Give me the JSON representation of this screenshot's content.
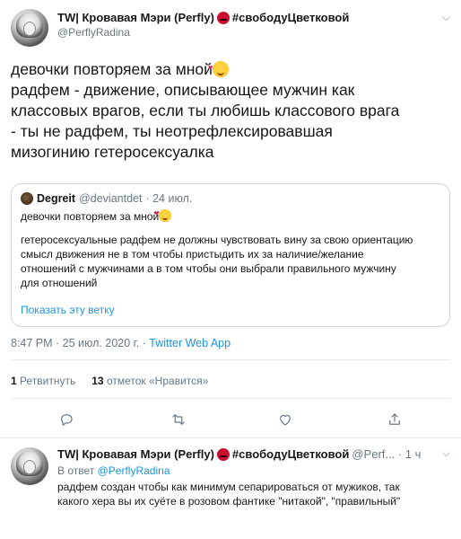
{
  "tweet": {
    "display_name": "TW| Кровавая Мэри (Perfly)",
    "hashtag": "#свободуЦветковой",
    "handle": "@PerflyRadina",
    "text_lines": [
      "девочки повторяем за мной",
      "радфем - движение, описывающее мужчин как",
      "классовых врагов, если ты любишь классового врага",
      "- ты не радфем, ты неотрефлексировавшая",
      "мизогинию гетеросексуалка"
    ],
    "quote": {
      "name": "Degreit",
      "handle": "@deviantdet",
      "date": "· 24 июл.",
      "line1": "девочки повторяем за мной",
      "lines": [
        "гетеросексуальные радфем не должны чувствовать вину за свою ориентацию",
        "смысл движения не в том чтобы пристыдить их за наличие/желание",
        "отношений с мужчинами а в том чтобы они выбрали правильного мужчину",
        "для отношений"
      ],
      "show_thread": "Показать эту ветку"
    },
    "time": "8:47 PM",
    "date": "· 25 июл. 2020 г. ·",
    "app": "Twitter Web App",
    "retweets_count": "1",
    "retweets_label": "Ретвитнуть",
    "likes_count": "13",
    "likes_label": "отметок «Нравится»"
  },
  "reply": {
    "display_name": "TW| Кровавая Мэри (Perfly)",
    "hashtag": "#свободуЦветковой",
    "meta": "@Perf... · 1 ч",
    "reply_prefix": "В ответ",
    "reply_to": "@PerflyRadina",
    "text_lines": [
      "радфем создан чтобы как минимум сепарироваться от мужиков, так",
      "какого хера вы их суёте в розовом фантике \"нитакой\", \"правильный\""
    ]
  },
  "icons": {
    "menu": "chevron-down-icon",
    "reply": "reply-icon",
    "retweet": "retweet-icon",
    "like": "heart-icon",
    "share": "share-icon"
  },
  "colors": {
    "link": "#1b95e0",
    "muted": "#657786",
    "text": "#14171a",
    "border": "#ccd6dd"
  }
}
